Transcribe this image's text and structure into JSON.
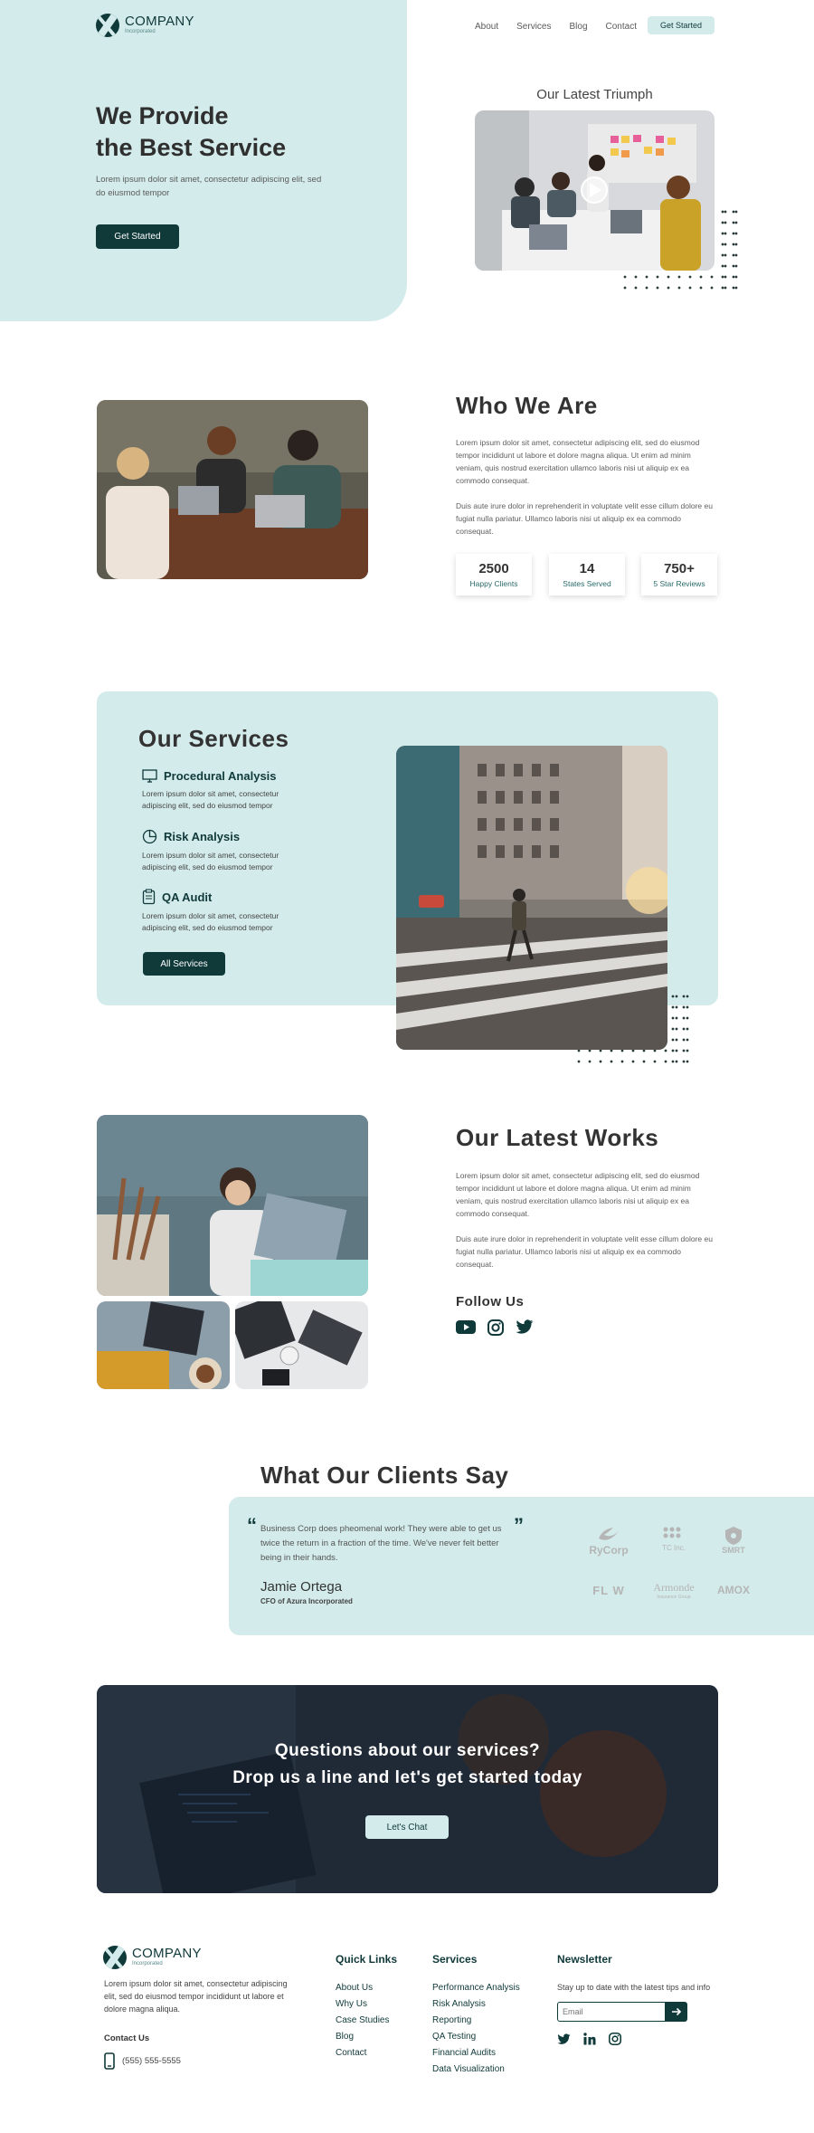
{
  "brand": {
    "name": "COMPANY",
    "tagline": "Incorporated"
  },
  "nav": {
    "items": [
      "About",
      "Services",
      "Blog",
      "Contact"
    ],
    "cta": "Get Started"
  },
  "hero": {
    "title_line1": "We Provide",
    "title_line2": "the Best Service",
    "text": "Lorem ipsum dolor sit amet, consectetur adipiscing elit, sed do eiusmod tempor",
    "cta": "Get Started",
    "video_title": "Our Latest Triumph"
  },
  "about": {
    "title": "Who We Are",
    "p1": "Lorem ipsum dolor sit amet, consectetur adipiscing elit, sed do eiusmod tempor incididunt ut labore et dolore magna aliqua. Ut enim ad minim veniam, quis nostrud exercitation ullamco laboris nisi ut aliquip ex ea commodo consequat.",
    "p2": "Duis aute irure dolor in reprehenderit in voluptate velit esse cillum dolore eu fugiat nulla pariatur. Ullamco laboris nisi ut aliquip ex ea commodo consequat.",
    "stats": [
      {
        "value": "2500",
        "label": "Happy Clients"
      },
      {
        "value": "14",
        "label": "States Served"
      },
      {
        "value": "750+",
        "label": "5 Star Reviews"
      }
    ]
  },
  "services": {
    "title": "Our Services",
    "items": [
      {
        "icon": "monitor-icon",
        "name": "Procedural Analysis",
        "desc": "Lorem ipsum dolor sit amet, consectetur adipiscing elit, sed do eiusmod tempor"
      },
      {
        "icon": "pie-chart-icon",
        "name": "Risk Analysis",
        "desc": "Lorem ipsum dolor sit amet, consectetur adipiscing elit, sed do eiusmod tempor"
      },
      {
        "icon": "clipboard-icon",
        "name": "QA Audit",
        "desc": "Lorem ipsum dolor sit amet, consectetur adipiscing elit, sed do eiusmod tempor"
      }
    ],
    "cta": "All Services"
  },
  "works": {
    "title": "Our Latest Works",
    "p1": "Lorem ipsum dolor sit amet, consectetur adipiscing elit, sed do eiusmod tempor incididunt ut labore et dolore magna aliqua. Ut enim ad minim veniam, quis nostrud exercitation ullamco laboris nisi ut aliquip ex ea commodo consequat.",
    "p2": "Duis aute irure dolor in reprehenderit in voluptate velit esse cillum dolore eu fugiat nulla pariatur. Ullamco laboris nisi ut aliquip ex ea commodo consequat.",
    "follow": "Follow Us"
  },
  "testimonials": {
    "title": "What Our Clients Say",
    "quote": "Business Corp does pheomenal work! They were able to get us twice the return in a fraction of the time. We've never felt better being in their hands.",
    "author": "Jamie Ortega",
    "role": "CFO of Azura Incorporated",
    "logos": [
      "RyCorp",
      "TC Inc.",
      "SMRT",
      "FL  W",
      "Armonde",
      "AMOX"
    ],
    "logo_sub": "Insurance Group"
  },
  "cta_banner": {
    "line1": "Questions about our services?",
    "line2": "Drop us a line and let's get started today",
    "button": "Let's Chat"
  },
  "footer": {
    "about": "Lorem ipsum dolor sit amet, consectetur adipiscing elit, sed do eiusmod tempor incididunt ut labore et dolore magna aliqua.",
    "contact_heading": "Contact Us",
    "phone": "(555) 555-5555",
    "quick_heading": "Quick Links",
    "quick_links": [
      "About Us",
      "Why Us",
      "Case Studies",
      "Blog",
      "Contact"
    ],
    "services_heading": "Services",
    "service_links": [
      "Performance Analysis",
      "Risk Analysis",
      "Reporting",
      "QA Testing",
      "Financial Audits",
      "Data Visualization"
    ],
    "newsletter_heading": "Newsletter",
    "newsletter_text": "Stay up to date with the latest tips and info",
    "email_placeholder": "Email"
  },
  "colors": {
    "dark": "#10393a",
    "mint": "#d3ebea"
  }
}
